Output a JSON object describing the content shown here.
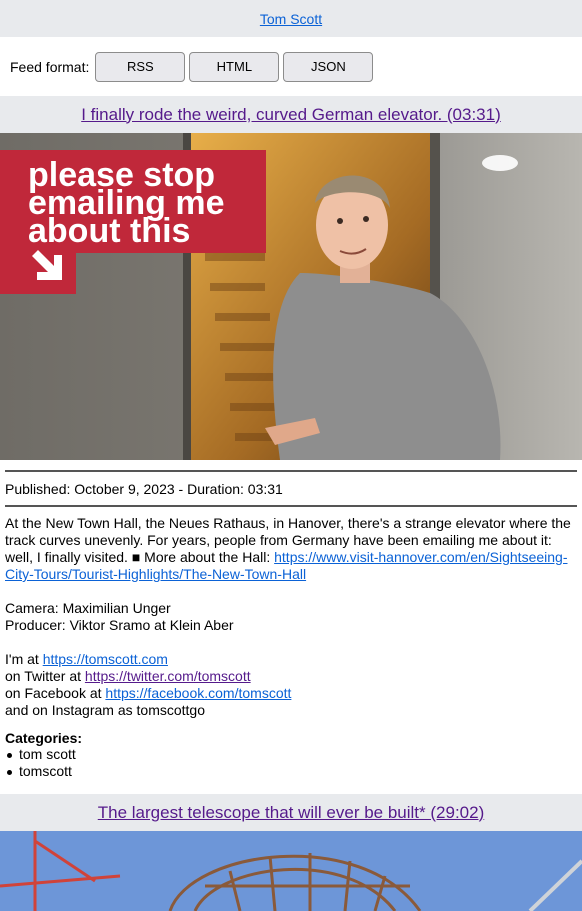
{
  "channel": {
    "name": "Tom Scott"
  },
  "feed": {
    "label": "Feed format:",
    "buttons": [
      "RSS",
      "HTML",
      "JSON"
    ]
  },
  "videos": [
    {
      "title": "I finally rode the weird, curved German elevator. (03:31)",
      "thumbnail_text": [
        "please stop",
        "emailing me",
        "about this"
      ],
      "published": "Published: October 9, 2023 - Duration: 03:31",
      "description": {
        "intro": "At the New Town Hall, the Neues Rathaus, in Hanover, there's a strange elevator where the track curves unevenly. For years, people from Germany have been emailing me about it: well, I finally visited. ■ More about the Hall: ",
        "hall_link": "https://www.visit-hannover.com/en/Sightseeing-City-Tours/Tourist-Highlights/The-New-Town-Hall",
        "camera": "Camera: Maximilian Unger",
        "producer": "Producer: Viktor Sramo at Klein Aber",
        "im_at": "I'm at ",
        "site_link": "https://tomscott.com",
        "twitter_prefix": "on Twitter at ",
        "twitter_link": "https://twitter.com/tomscott",
        "facebook_prefix": "on Facebook at ",
        "facebook_link": "https://facebook.com/tomscott",
        "instagram": "and on Instagram as tomscottgo"
      },
      "categories_label": "Categories:",
      "categories": [
        "tom scott",
        "tomscott"
      ]
    },
    {
      "title": "The largest telescope that will ever be built* (29:02)"
    }
  ],
  "colors": {
    "bar_bg": "#e8eaed",
    "link": "#0b62d6",
    "visited": "#551a8b",
    "thumb_banner": "#c0283a"
  }
}
